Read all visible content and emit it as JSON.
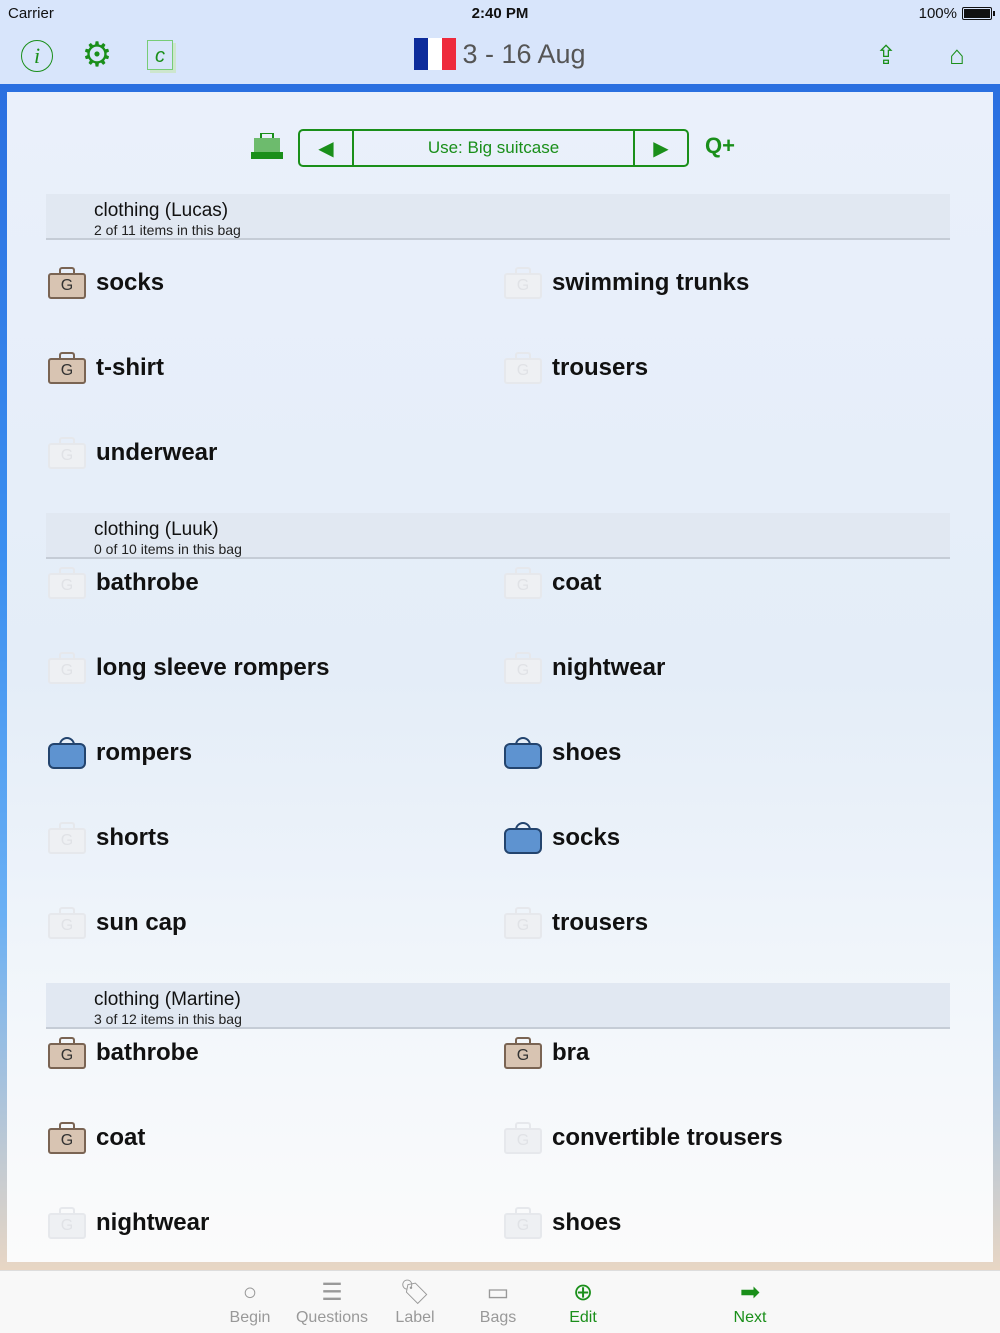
{
  "status": {
    "carrier": "Carrier",
    "time": "2:40 PM",
    "battery": "100%"
  },
  "nav": {
    "title": "3 - 16 Aug",
    "flag_colors": [
      "#0d2c9b",
      "#ffffff",
      "#ee2a3c"
    ]
  },
  "bag_selector": {
    "label": "Use: Big suitcase",
    "prev": "◀",
    "next": "▶",
    "zoom": "Q+"
  },
  "sections": [
    {
      "name": "clothing (Lucas)",
      "count": "2 of 11 items in this bag",
      "items": [
        {
          "label": "socks",
          "state": "packed"
        },
        {
          "label": "swimming trunks",
          "state": "none"
        },
        {
          "label": "t-shirt",
          "state": "packed"
        },
        {
          "label": "trousers",
          "state": "none"
        },
        {
          "label": "underwear",
          "state": "none"
        }
      ]
    },
    {
      "name": "clothing (Luuk)",
      "count": "0 of 10 items in this bag",
      "items": [
        {
          "label": "bathrobe",
          "state": "none"
        },
        {
          "label": "coat",
          "state": "none"
        },
        {
          "label": "long sleeve rompers",
          "state": "none"
        },
        {
          "label": "nightwear",
          "state": "none"
        },
        {
          "label": "rompers",
          "state": "other"
        },
        {
          "label": "shoes",
          "state": "other"
        },
        {
          "label": "shorts",
          "state": "none"
        },
        {
          "label": "socks",
          "state": "other"
        },
        {
          "label": "sun cap",
          "state": "none"
        },
        {
          "label": "trousers",
          "state": "none"
        }
      ]
    },
    {
      "name": "clothing (Martine)",
      "count": "3 of 12 items in this bag",
      "items": [
        {
          "label": "bathrobe",
          "state": "packed"
        },
        {
          "label": "bra",
          "state": "packed"
        },
        {
          "label": "coat",
          "state": "packed"
        },
        {
          "label": "convertible trousers",
          "state": "none"
        },
        {
          "label": "nightwear",
          "state": "none"
        },
        {
          "label": "shoes",
          "state": "none"
        }
      ]
    }
  ],
  "tabs": [
    {
      "label": "Begin",
      "icon": "○"
    },
    {
      "label": "Questions",
      "icon": "☰"
    },
    {
      "label": "Label",
      "icon": "🏷"
    },
    {
      "label": "Bags",
      "icon": "▭"
    },
    {
      "label": "Edit",
      "icon": "⊕"
    },
    {
      "label": "Next",
      "icon": "➡"
    }
  ],
  "bag_glyph": "G"
}
